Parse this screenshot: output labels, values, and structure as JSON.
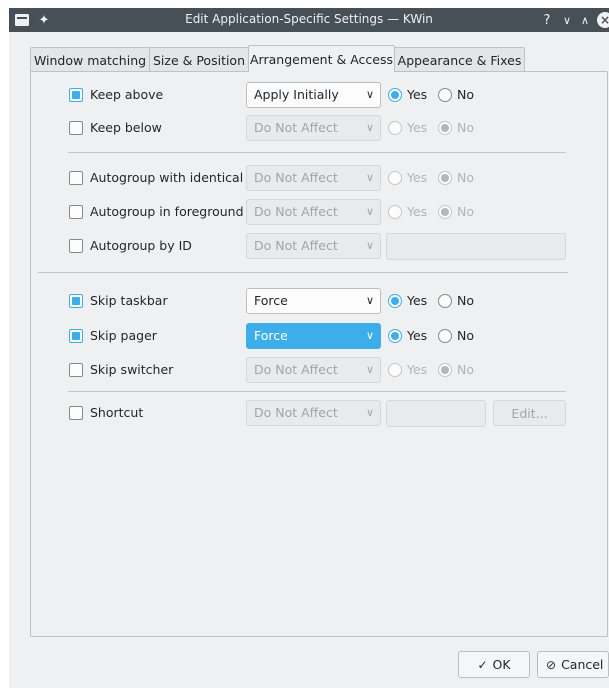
{
  "window": {
    "title": "Edit Application-Specific Settings — KWin",
    "help_glyph": "?",
    "minimize_glyph": "∨",
    "maximize_glyph": "∧",
    "close_glyph": "×",
    "pin_glyph": "✦"
  },
  "tabs": [
    {
      "label": "Window matching",
      "active": false
    },
    {
      "label": "Size & Position",
      "active": false
    },
    {
      "label": "Arrangement & Access",
      "active": true
    },
    {
      "label": "Appearance & Fixes",
      "active": false
    }
  ],
  "rules": {
    "keep_above": {
      "label": "Keep above",
      "checked": true,
      "policy": "Apply Initially",
      "yes": "Yes",
      "no": "No",
      "value": "Yes"
    },
    "keep_below": {
      "label": "Keep below",
      "checked": false,
      "policy": "Do Not Affect",
      "yes": "Yes",
      "no": "No",
      "value": "No"
    },
    "autogroup_identical": {
      "label": "Autogroup with identical",
      "checked": false,
      "policy": "Do Not Affect",
      "yes": "Yes",
      "no": "No",
      "value": "No"
    },
    "autogroup_foreground": {
      "label": "Autogroup in foreground",
      "checked": false,
      "policy": "Do Not Affect",
      "yes": "Yes",
      "no": "No",
      "value": "No"
    },
    "autogroup_id": {
      "label": "Autogroup by ID",
      "checked": false,
      "policy": "Do Not Affect",
      "value": ""
    },
    "skip_taskbar": {
      "label": "Skip taskbar",
      "checked": true,
      "policy": "Force",
      "yes": "Yes",
      "no": "No",
      "value": "Yes"
    },
    "skip_pager": {
      "label": "Skip pager",
      "checked": true,
      "policy": "Force",
      "yes": "Yes",
      "no": "No",
      "value": "Yes"
    },
    "skip_switcher": {
      "label": "Skip switcher",
      "checked": false,
      "policy": "Do Not Affect",
      "yes": "Yes",
      "no": "No",
      "value": "No"
    },
    "shortcut": {
      "label": "Shortcut",
      "checked": false,
      "policy": "Do Not Affect",
      "value": "",
      "edit_label": "Edit..."
    }
  },
  "chevron_glyph": "∨",
  "footer": {
    "ok_label": "OK",
    "ok_glyph": "✓",
    "cancel_label": "Cancel",
    "cancel_glyph": "⊘"
  },
  "colors": {
    "accent": "#3daee9",
    "titlebar": "#475057",
    "window_bg": "#eff0f1"
  }
}
